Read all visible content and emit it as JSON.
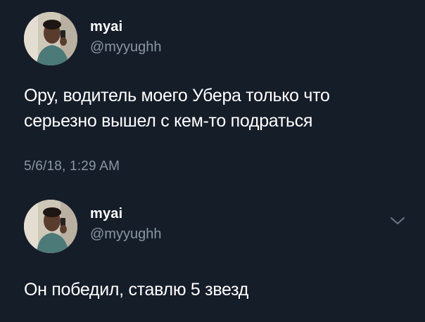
{
  "tweets": [
    {
      "display_name": "myai",
      "handle": "@myyughh",
      "text": "Ору, водитель моего Убера только что серьезно вышел с кем-то подраться",
      "timestamp": "5/6/18, 1:29 AM",
      "avatar_icon": "user-avatar"
    },
    {
      "display_name": "myai",
      "handle": "@myyughh",
      "text": "Он победил, ставлю 5 звезд",
      "avatar_icon": "user-avatar",
      "menu_icon": "chevron-down-icon"
    }
  ],
  "colors": {
    "background": "#151d29",
    "text_primary": "#ffffff",
    "text_secondary": "#8a96a3",
    "chevron": "#6b7886"
  }
}
